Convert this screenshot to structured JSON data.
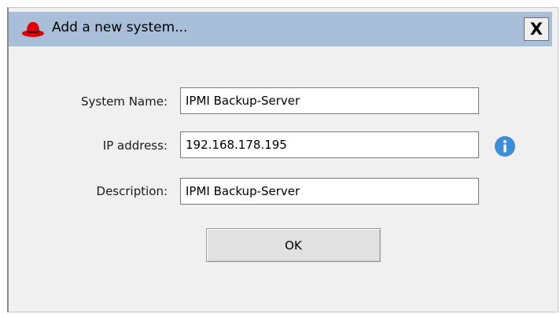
{
  "dialog": {
    "title": "Add a new system...",
    "close_label": "X",
    "app_icon": "red-hat-icon",
    "colors": {
      "titlebar": "#a9bfd9",
      "body": "#f0f0f0",
      "brand_red": "#e00000",
      "info_blue": "#3c8ed8"
    }
  },
  "form": {
    "system_name": {
      "label": "System Name:",
      "value": "IPMI Backup-Server"
    },
    "ip_address": {
      "label": "IP address:",
      "value": "192.168.178.195",
      "icon": "info-icon"
    },
    "description": {
      "label": "Description:",
      "value": "IPMI Backup-Server"
    }
  },
  "actions": {
    "ok_label": "OK"
  }
}
